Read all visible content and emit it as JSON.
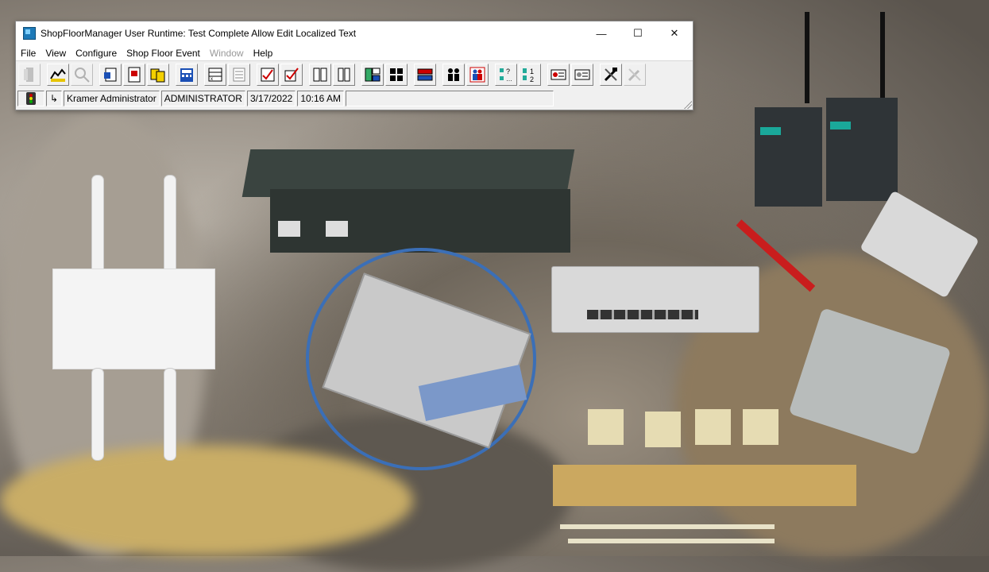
{
  "window": {
    "title": "ShopFloorManager User Runtime: Test Complete Allow Edit Localized Text",
    "controls": {
      "minimize": "—",
      "maximize": "☐",
      "close": "✕"
    }
  },
  "menu": {
    "file": "File",
    "view": "View",
    "configure": "Configure",
    "shop_floor_event": "Shop Floor Event",
    "window": "Window",
    "help": "Help"
  },
  "status": {
    "user": "Kramer Administrator",
    "role": "ADMINISTRATOR",
    "date": "3/17/2022",
    "time": "10:16 AM"
  },
  "toolbar_icons": [
    "exit-icon",
    "chart-icon",
    "zoom-icon",
    "document-icon",
    "report-icon",
    "copies-icon",
    "calculator-icon",
    "grid-icon",
    "list-icon",
    "checklist-icon",
    "checklist-2-icon",
    "columns-icon",
    "columns-2-icon",
    "dashboard-icon",
    "layout-icon",
    "server-icon",
    "people-icon",
    "people-2-icon",
    "question-icon",
    "number-icon",
    "card-icon",
    "card-2-icon",
    "tools-icon",
    "tools-disabled-icon"
  ],
  "colors": {
    "accent": "#1e7ab8",
    "window_bg": "#f0f0f0"
  }
}
